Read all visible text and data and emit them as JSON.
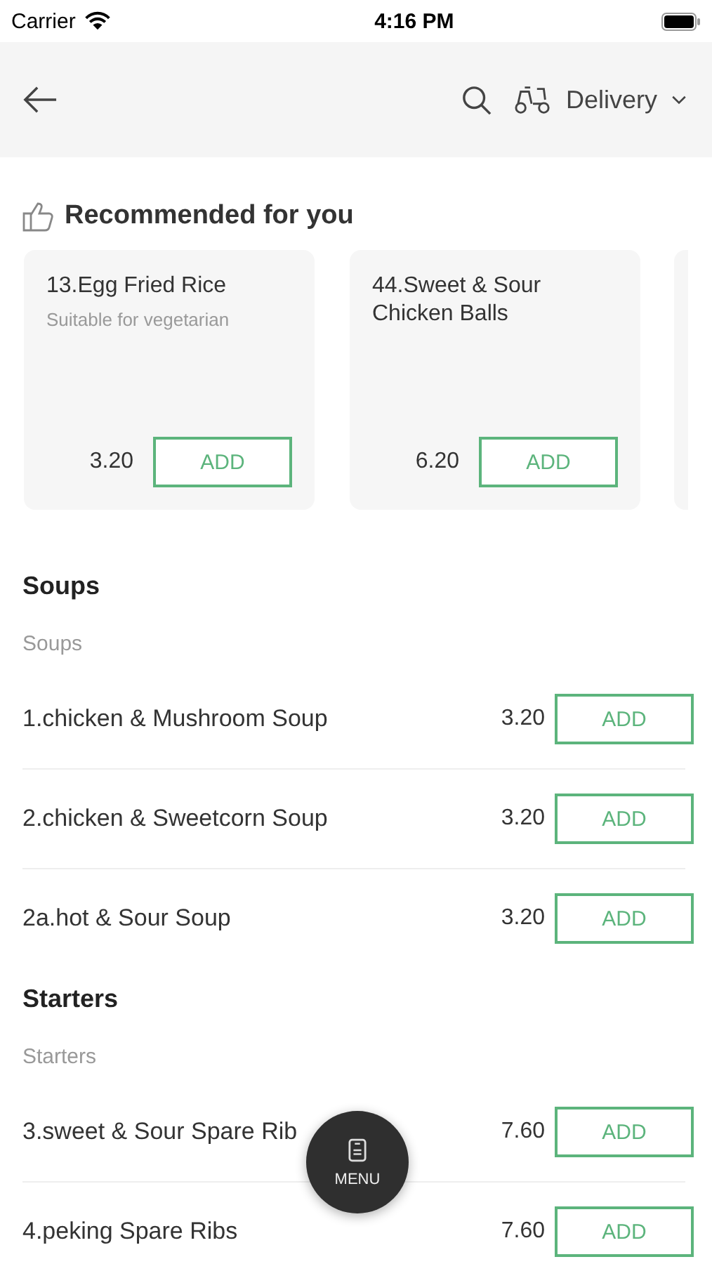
{
  "status_bar": {
    "carrier": "Carrier",
    "time": "4:16 PM"
  },
  "header": {
    "mode": "Delivery"
  },
  "recommended": {
    "title": "Recommended for you",
    "items": [
      {
        "name": "13.Egg Fried Rice",
        "note": "Suitable for vegetarian",
        "price": "3.20",
        "button": "ADD"
      },
      {
        "name": "44.Sweet & Sour Chicken Balls",
        "price": "6.20",
        "button": "ADD"
      }
    ]
  },
  "sections": [
    {
      "title": "Soups",
      "subtitle": "Soups",
      "items": [
        {
          "name": "1.chicken & Mushroom Soup",
          "price": "3.20",
          "button": "ADD"
        },
        {
          "name": "2.chicken & Sweetcorn Soup",
          "price": "3.20",
          "button": "ADD"
        },
        {
          "name": "2a.hot & Sour Soup",
          "price": "3.20",
          "button": "ADD"
        }
      ]
    },
    {
      "title": "Starters",
      "subtitle": "Starters",
      "items": [
        {
          "name": "3.sweet & Sour Spare Rib",
          "price": "7.60",
          "button": "ADD"
        },
        {
          "name": "4.peking Spare Ribs",
          "price": "7.60",
          "button": "ADD"
        }
      ]
    }
  ],
  "menu_button": {
    "label": "MENU"
  }
}
